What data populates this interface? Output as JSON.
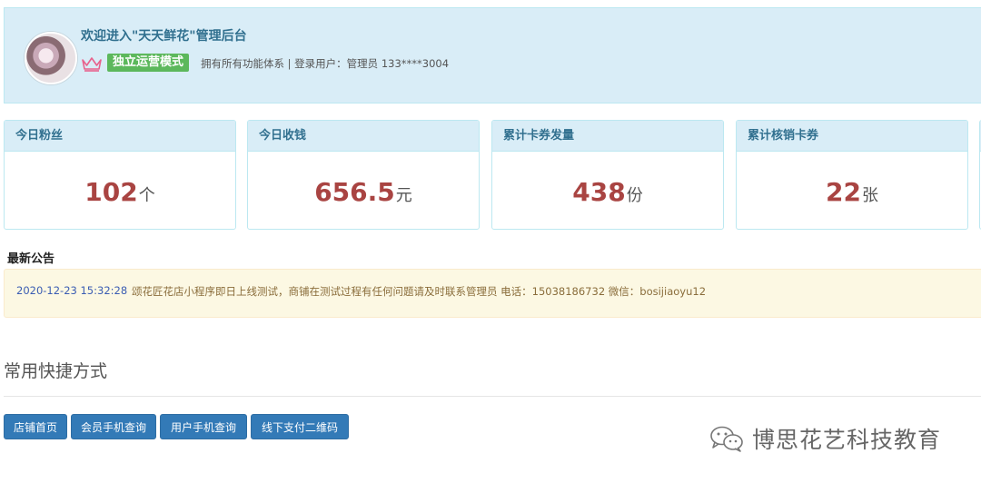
{
  "header": {
    "welcome": "欢迎进入\"天天鲜花\"管理后台",
    "mode_badge": "独立运营模式",
    "description": "拥有所有功能体系 | 登录用户：管理员 133****3004",
    "crown_icon": "crown-icon",
    "crown_color": "#e8618c"
  },
  "stats": [
    {
      "label": "今日粉丝",
      "value": "102",
      "unit": "个"
    },
    {
      "label": "今日收钱",
      "value": "656.5",
      "unit": "元"
    },
    {
      "label": "累计卡券发量",
      "value": "438",
      "unit": "份"
    },
    {
      "label": "累计核销卡券",
      "value": "22",
      "unit": "张"
    }
  ],
  "announcement": {
    "title": "最新公告",
    "date": "2020-12-23 15:32:28",
    "text": "颂花匠花店小程序即日上线测试，商铺在测试过程有任何问题请及时联系管理员 电话：15038186732 微信：bosijiaoyu12"
  },
  "shortcuts": {
    "title": "常用快捷方式",
    "buttons": [
      "店铺首页",
      "会员手机查询",
      "用户手机查询",
      "线下支付二维码"
    ]
  },
  "watermark": {
    "text": "博思花艺科技教育",
    "icon": "wechat-icon"
  },
  "colors": {
    "banner_bg": "#d9edf7",
    "stat_value": "#a94442",
    "button_bg": "#337ab7",
    "badge_bg": "#5cb85c",
    "notice_bg": "#fcf8e3"
  }
}
